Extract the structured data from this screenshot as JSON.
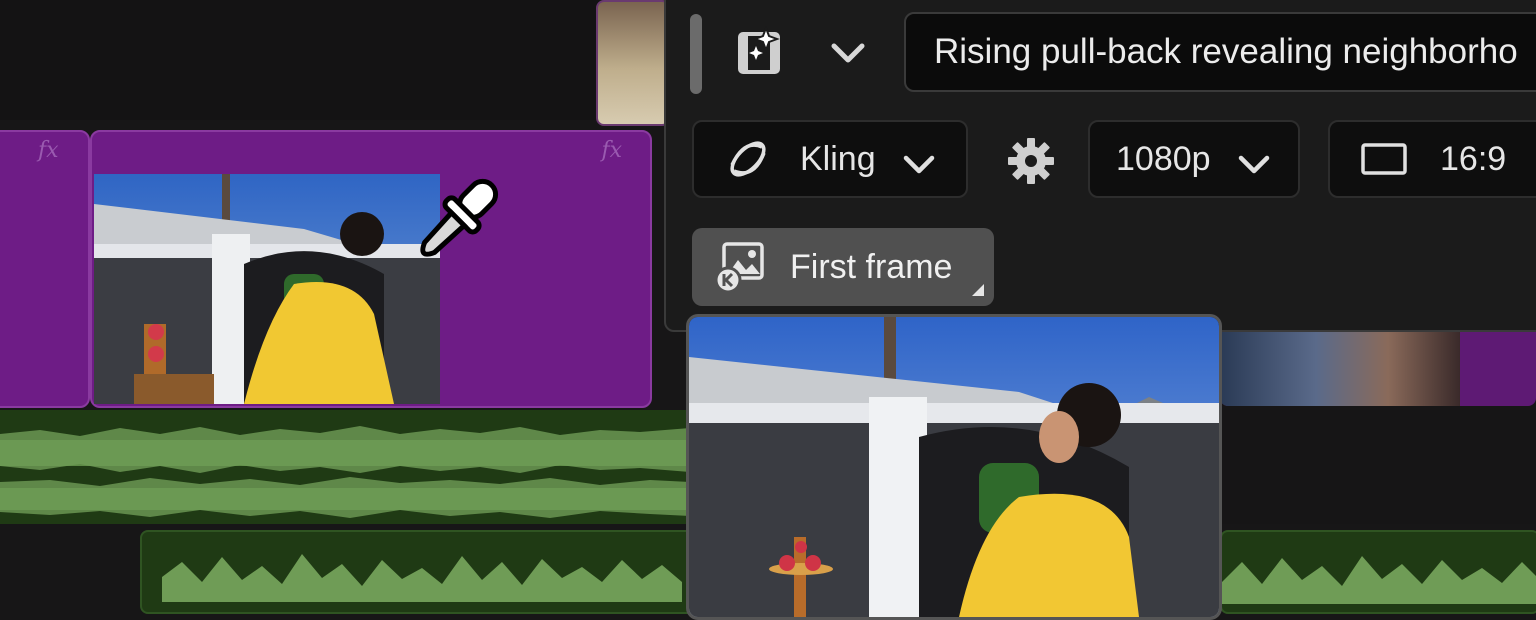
{
  "prompt": {
    "text": "Rising pull-back revealing neighborho"
  },
  "toolbar": {
    "model_label": "Kling",
    "resolution_label": "1080p",
    "aspect_label": "16:9",
    "first_frame_label": "First frame"
  },
  "timeline": {
    "fx_badge": "fx"
  },
  "colors": {
    "clip_purple": "#6e1c86",
    "audio_green": "#1f3a14",
    "panel_bg": "#1b1b1b"
  },
  "icons": [
    "generate-video-icon",
    "chevron-down-icon",
    "kling-logo-icon",
    "gear-icon",
    "aspect-ratio-icon",
    "first-frame-icon",
    "eyedropper-icon"
  ]
}
